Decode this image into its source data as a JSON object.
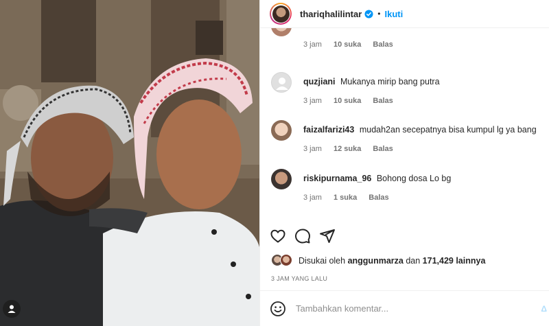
{
  "photo": {
    "alt_icon": "person-tag-icon"
  },
  "header": {
    "username": "thariqhalilintar",
    "separator": "•",
    "follow_label": "Ikuti"
  },
  "comments": [
    {
      "username": "",
      "text": "",
      "time": "3 jam",
      "likes": "10 suka",
      "reply": "Balas"
    },
    {
      "username": "quzjiani",
      "text": "Mukanya mirip bang putra",
      "time": "3 jam",
      "likes": "10 suka",
      "reply": "Balas"
    },
    {
      "username": "faizalfarizi43",
      "text": "mudah2an secepatnya bisa kumpul lg ya bang",
      "time": "3 jam",
      "likes": "12 suka",
      "reply": "Balas"
    },
    {
      "username": "riskipurnama_96",
      "text": "Bohong dosa Lo bg",
      "time": "3 jam",
      "likes": "1 suka",
      "reply": "Balas"
    }
  ],
  "liked": {
    "prefix": "Disukai oleh",
    "user": "anggunmarza",
    "middle": "dan",
    "count": "171,429 lainnya"
  },
  "timestamp": "3 JAM YANG LALU",
  "add_comment": {
    "placeholder": "Tambahkan komentar...",
    "post_label": "Δ"
  },
  "colors": {
    "accent": "#0095f6",
    "verified": "#0095f6"
  }
}
